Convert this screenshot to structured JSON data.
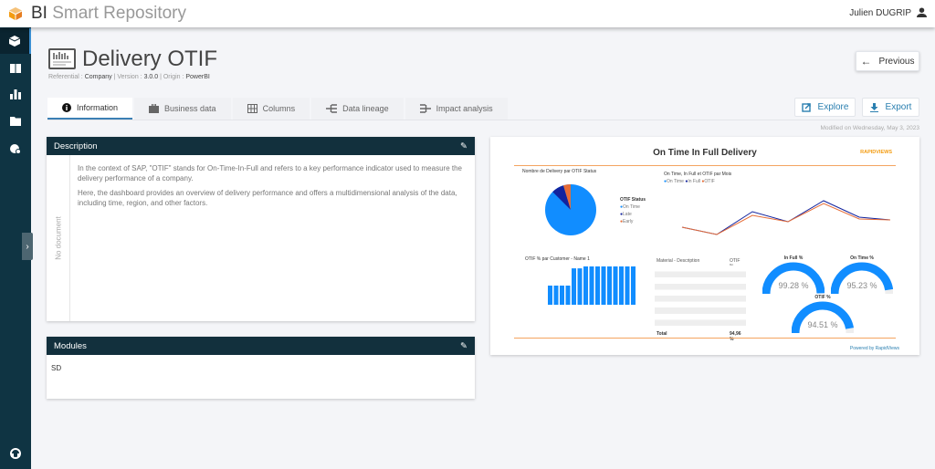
{
  "app": {
    "title_bold": "BI",
    "title_rest": " Smart Repository",
    "user": "Julien DUGRIP"
  },
  "sidebar": {
    "items": [
      "cube-icon",
      "book-icon",
      "chart-icon",
      "folder-icon",
      "cloud-settings-icon"
    ],
    "bottom": "support-icon"
  },
  "page": {
    "title": "Delivery OTIF",
    "referential_label": "Referential : ",
    "referential": "Company",
    "version_label": "Version : ",
    "version": "3.0.0",
    "origin_label": "Origin : ",
    "origin": "PowerBI",
    "modified": "Modified on Wednesday, May 3, 2023"
  },
  "tabs": [
    {
      "label": "Information",
      "active": true
    },
    {
      "label": "Business data"
    },
    {
      "label": "Columns"
    },
    {
      "label": "Data lineage"
    },
    {
      "label": "Impact analysis"
    }
  ],
  "buttons": {
    "previous": "Previous",
    "explore": "Explore",
    "export": "Export"
  },
  "description": {
    "header": "Description",
    "side_label": "No document",
    "paragraphs": [
      "In the context of SAP, \"OTIF\" stands for On-Time-In-Full and refers to a key performance indicator used to measure the delivery performance of a company.",
      "Here, the dashboard provides an overview of delivery performance and offers a multidimensional analysis of the data, including time, region, and other factors."
    ]
  },
  "modules": {
    "header": "Modules",
    "value": "SD"
  },
  "preview": {
    "title": "On Time In Full Delivery",
    "brand": "RAPIDVIEWS",
    "pie_title": "Nombre de Delivery par OTIF Status",
    "legend_title": "OTIF Status",
    "legend": [
      "On Time",
      "Late",
      "Early"
    ],
    "line_title": "On Time, In Full et OTIF par Mois",
    "line_legend": [
      "On Time",
      "In Full",
      "OTIF"
    ],
    "bar_title": "OTIF % par Customer - Name 1",
    "table_header": [
      "Material - Description",
      "OTIF %"
    ],
    "table_total": [
      "Total",
      "94,96 %"
    ],
    "gauges": [
      {
        "label": "In Full %",
        "value": "99.28 %",
        "pct": 99.28
      },
      {
        "label": "On Time %",
        "value": "95.23 %",
        "pct": 95.23
      },
      {
        "label": "OTIF %",
        "value": "94.51 %",
        "pct": 94.51
      }
    ],
    "powered": "Powered by RapidViews",
    "colors": {
      "on_time": "#118dff",
      "late": "#12239e",
      "early": "#e66c37",
      "accent": "#f4a460"
    }
  }
}
